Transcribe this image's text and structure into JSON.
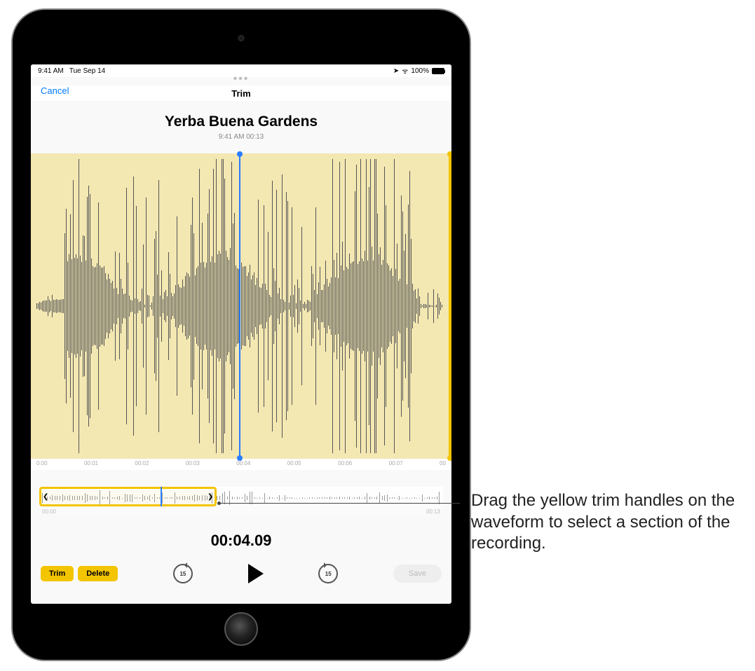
{
  "status_bar": {
    "time": "9:41 AM",
    "date": "Tue Sep 14",
    "wifi": "100%",
    "wifi_symbol": "ᯤ",
    "location_symbol": "➤"
  },
  "nav": {
    "cancel": "Cancel",
    "title": "Trim"
  },
  "recording": {
    "title": "Yerba Buena Gardens",
    "subtitle": "9:41 AM  00:13"
  },
  "ticks": [
    "0:00",
    "00:01",
    "00:02",
    "00:03",
    "00:04",
    "00:05",
    "00:06",
    "00:07",
    "00"
  ],
  "overview": {
    "start": "00:00",
    "end": "00:13",
    "left_handle": "❮",
    "right_handle": "❯"
  },
  "timecode": "00:04.09",
  "controls": {
    "trim": "Trim",
    "delete": "Delete",
    "skip_back": "15",
    "skip_fwd": "15",
    "save": "Save"
  },
  "callout": "Drag the yellow trim handles on the waveform to select a section of the recording."
}
